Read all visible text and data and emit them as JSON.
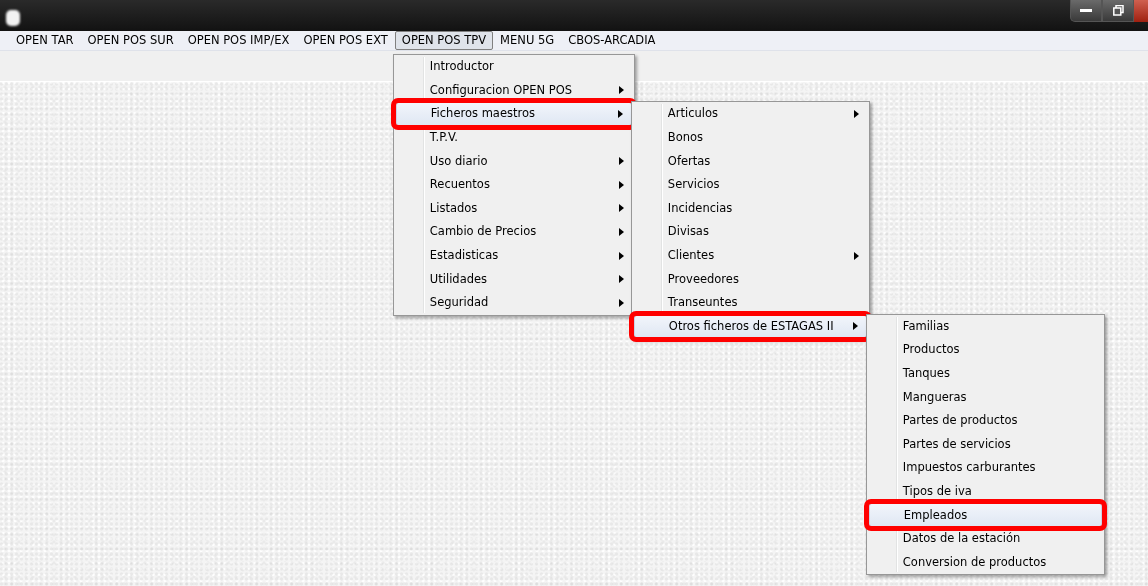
{
  "menubar": [
    {
      "label": "OPEN TAR",
      "selected": false
    },
    {
      "label": "OPEN POS SUR",
      "selected": false
    },
    {
      "label": "OPEN POS IMP/EX",
      "selected": false
    },
    {
      "label": "OPEN POS EXT",
      "selected": false
    },
    {
      "label": "OPEN POS TPV",
      "selected": true,
      "menu": [
        {
          "label": "Introductor",
          "submenu": false,
          "selected": false,
          "highlighted": false
        },
        {
          "label": "Configuracion OPEN POS",
          "submenu": true,
          "selected": false,
          "highlighted": false
        },
        {
          "label": "Ficheros maestros",
          "submenu": true,
          "selected": true,
          "highlighted": true,
          "children": [
            {
              "label": "Articulos",
              "submenu": true,
              "selected": false,
              "highlighted": false
            },
            {
              "label": "Bonos",
              "submenu": false,
              "selected": false,
              "highlighted": false
            },
            {
              "label": "Ofertas",
              "submenu": false,
              "selected": false,
              "highlighted": false
            },
            {
              "label": "Servicios",
              "submenu": false,
              "selected": false,
              "highlighted": false
            },
            {
              "label": "Incidencias",
              "submenu": false,
              "selected": false,
              "highlighted": false
            },
            {
              "label": "Divisas",
              "submenu": false,
              "selected": false,
              "highlighted": false
            },
            {
              "label": "Clientes",
              "submenu": true,
              "selected": false,
              "highlighted": false
            },
            {
              "label": "Proveedores",
              "submenu": false,
              "selected": false,
              "highlighted": false
            },
            {
              "label": "Transeuntes",
              "submenu": false,
              "selected": false,
              "highlighted": false
            },
            {
              "label": "Otros ficheros de ESTAGAS II",
              "submenu": true,
              "selected": true,
              "highlighted": true,
              "children": [
                {
                  "label": "Familias",
                  "submenu": false,
                  "selected": false,
                  "highlighted": false
                },
                {
                  "label": "Productos",
                  "submenu": false,
                  "selected": false,
                  "highlighted": false
                },
                {
                  "label": "Tanques",
                  "submenu": false,
                  "selected": false,
                  "highlighted": false
                },
                {
                  "label": "Mangueras",
                  "submenu": false,
                  "selected": false,
                  "highlighted": false
                },
                {
                  "label": "Partes de productos",
                  "submenu": false,
                  "selected": false,
                  "highlighted": false
                },
                {
                  "label": "Partes de servicios",
                  "submenu": false,
                  "selected": false,
                  "highlighted": false
                },
                {
                  "label": "Impuestos carburantes",
                  "submenu": false,
                  "selected": false,
                  "highlighted": false
                },
                {
                  "label": "Tipos de iva",
                  "submenu": false,
                  "selected": false,
                  "highlighted": false
                },
                {
                  "label": "Empleados",
                  "submenu": false,
                  "selected": true,
                  "highlighted": true
                },
                {
                  "label": "Datos de la estación",
                  "submenu": false,
                  "selected": false,
                  "highlighted": false
                },
                {
                  "label": "Conversion de productos",
                  "submenu": false,
                  "selected": false,
                  "highlighted": false
                }
              ]
            }
          ]
        },
        {
          "label": "T.P.V.",
          "submenu": false,
          "selected": false,
          "highlighted": false
        },
        {
          "label": "Uso diario",
          "submenu": true,
          "selected": false,
          "highlighted": false
        },
        {
          "label": "Recuentos",
          "submenu": true,
          "selected": false,
          "highlighted": false
        },
        {
          "label": "Listados",
          "submenu": true,
          "selected": false,
          "highlighted": false
        },
        {
          "label": "Cambio de Precios",
          "submenu": true,
          "selected": false,
          "highlighted": false
        },
        {
          "label": "Estadisticas",
          "submenu": true,
          "selected": false,
          "highlighted": false
        },
        {
          "label": "Utilidades",
          "submenu": true,
          "selected": false,
          "highlighted": false
        },
        {
          "label": "Seguridad",
          "submenu": true,
          "selected": false,
          "highlighted": false
        }
      ]
    },
    {
      "label": "MENU 5G",
      "selected": false
    },
    {
      "label": "CBOS-ARCADIA",
      "selected": false
    }
  ]
}
